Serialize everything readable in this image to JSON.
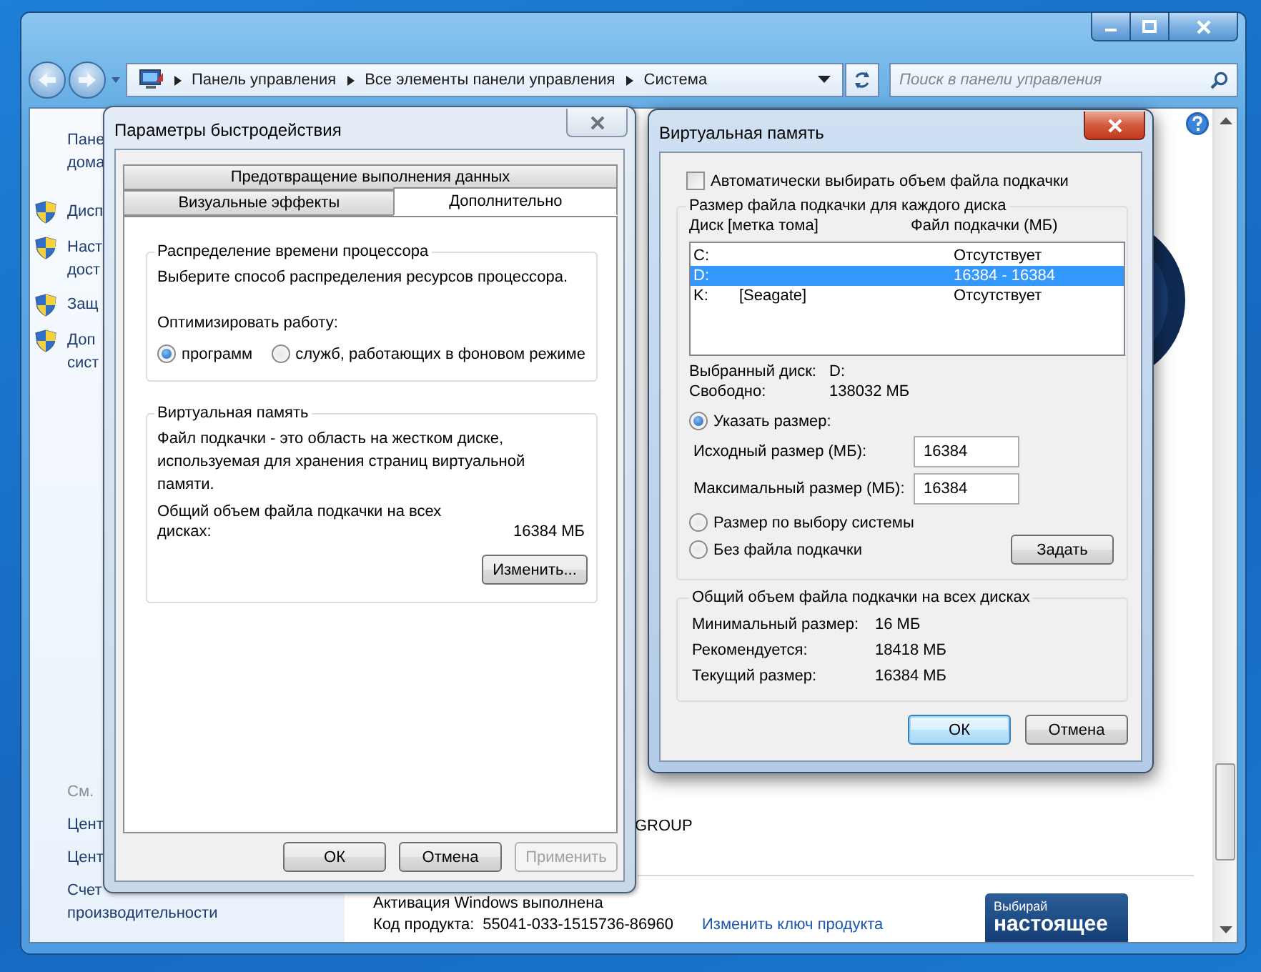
{
  "explorer": {
    "breadcrumb": [
      "Панель управления",
      "Все элементы панели управления",
      "Система"
    ],
    "search": {
      "placeholder": "Поиск в панели управления"
    },
    "nav_links": [
      {
        "kind": "plain",
        "lines": [
          "Пане",
          "дома"
        ]
      },
      {
        "kind": "shield",
        "lines": [
          "Дисп"
        ]
      },
      {
        "kind": "shield",
        "lines": [
          "Наст",
          "дост"
        ]
      },
      {
        "kind": "shield",
        "lines": [
          "Защ"
        ]
      },
      {
        "kind": "shield",
        "lines": [
          "Доп",
          "сист"
        ]
      }
    ],
    "see_also": {
      "heading": "См.",
      "links": [
        {
          "lines": [
            "Цент"
          ]
        },
        {
          "lines": [
            "Цент"
          ]
        },
        {
          "lines": [
            "Счет",
            "производительности"
          ]
        }
      ]
    },
    "workgroup": "GROUP",
    "activation": "Активация Windows выполнена",
    "product_key_label": "Код продукта:",
    "product_key": "55041-033-1515736-86960",
    "change_key_link": "Изменить ключ продукта",
    "banner": {
      "line1": "Выбирай",
      "line2": "настоящее"
    }
  },
  "perf_dialog": {
    "title": "Параметры быстродействия",
    "tab_rows": [
      [
        {
          "label": "Предотвращение выполнения данных",
          "selected": false
        }
      ],
      [
        {
          "label": "Визуальные эффекты",
          "selected": false
        },
        {
          "label": "Дополнительно",
          "selected": true
        }
      ]
    ],
    "cpu": {
      "title": "Распределение времени процессора",
      "text": "Выберите способ распределения ресурсов процессора.",
      "optimize_label": "Оптимизировать работу:",
      "options": [
        {
          "label": "программ",
          "selected": true
        },
        {
          "label": "служб, работающих в фоновом режиме",
          "selected": false
        }
      ]
    },
    "vm": {
      "title": "Виртуальная память",
      "text": "Файл подкачки - это область на жестком диске, используемая для хранения страниц виртуальной памяти.",
      "total_label": "Общий объем файла подкачки на всех дисках:",
      "total_value": "16384 МБ",
      "change_button": "Изменить..."
    },
    "buttons": [
      {
        "label": "ОК",
        "disabled": false
      },
      {
        "label": "Отмена",
        "disabled": false
      },
      {
        "label": "Применить",
        "disabled": true
      }
    ]
  },
  "vm_dialog": {
    "title": "Виртуальная память",
    "auto_size": {
      "label": "Автоматически выбирать объем файла подкачки",
      "checked": false
    },
    "disks": {
      "title": "Размер файла подкачки для каждого диска",
      "columns": [
        "Диск [метка тома]",
        "Файл подкачки (МБ)"
      ],
      "rows": [
        {
          "disk": "C:",
          "size": "Отсутствует",
          "selected": false
        },
        {
          "disk": "D:",
          "size": "16384 - 16384",
          "selected": true
        },
        {
          "disk": "K:",
          "label": "[Seagate]",
          "size": "Отсутствует",
          "selected": false
        }
      ],
      "selected_disk_label": "Выбранный диск:",
      "selected_disk": "D:",
      "free_label": "Свободно:",
      "free_value": "138032 МБ",
      "options": [
        {
          "label": "Указать размер:",
          "selected": true
        },
        {
          "label": "Размер по выбору системы",
          "selected": false
        },
        {
          "label": "Без файла подкачки",
          "selected": false
        }
      ],
      "fields": [
        {
          "label": "Исходный размер (МБ):",
          "value": "16384"
        },
        {
          "label": "Максимальный размер (МБ):",
          "value": "16384"
        }
      ],
      "set_button": "Задать"
    },
    "totals": {
      "title": "Общий объем файла подкачки на всех дисках",
      "rows": [
        {
          "label": "Минимальный размер:",
          "value": "16 МБ"
        },
        {
          "label": "Рекомендуется:",
          "value": "18418 МБ"
        },
        {
          "label": "Текущий размер:",
          "value": "16384 МБ"
        }
      ]
    },
    "buttons": [
      {
        "label": "ОК",
        "default": true
      },
      {
        "label": "Отмена",
        "default": false
      }
    ]
  }
}
